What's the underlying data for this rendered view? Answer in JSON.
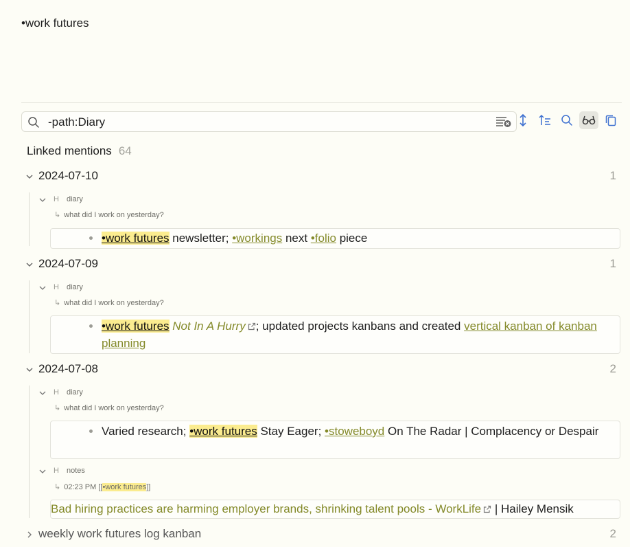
{
  "page": {
    "title": "•work futures"
  },
  "search": {
    "value": "-path:Diary"
  },
  "linked_mentions": {
    "label": "Linked mentions",
    "count": "64"
  },
  "groups": [
    {
      "date": "2024-07-10",
      "count": "1",
      "heading": "diary",
      "crumb": "what did I work on yesterday?",
      "block": {
        "tag": "•work futures",
        "t1": " newsletter; ",
        "link1": "•workings",
        "t2": " next ",
        "link2": "•folio",
        "t3": " piece"
      }
    },
    {
      "date": "2024-07-09",
      "count": "1",
      "heading": "diary",
      "crumb": "what did I work on yesterday?",
      "block": {
        "tag": "•work futures",
        "ref": "Not In A Hurry",
        "t1": "; updated projects kanbans and created ",
        "link1": "vertical kanban of kanban planning"
      }
    },
    {
      "date": "2024-07-08",
      "count": "2",
      "heading": "diary",
      "crumb": "what did I work on yesterday?",
      "block": {
        "t0": "Varied research; ",
        "tag": "•work futures",
        "t1": " Stay Eager; ",
        "link1": "•stoweboyd",
        "t2": " On The Radar | Complacency or Despair"
      },
      "heading2": "notes",
      "crumb2_prefix": "02:23 PM [[",
      "crumb2_tag": "•work futures",
      "crumb2_suffix": "]]",
      "block2": {
        "link": "Bad hiring practices are harming employer brands, shrinking talent pools - WorkLife",
        "tail": " | Hailey Mensik"
      }
    },
    {
      "date": "weekly work futures log kanban",
      "count": "2"
    }
  ]
}
